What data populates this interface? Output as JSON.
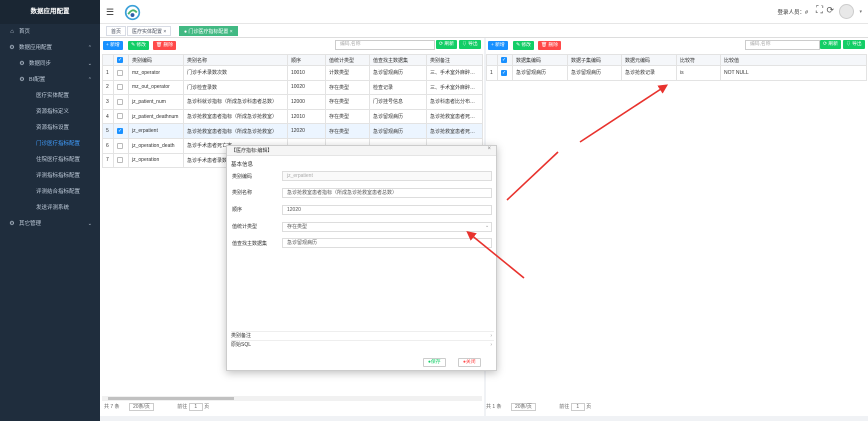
{
  "sidebar": {
    "title": "数据应用配置",
    "items": [
      {
        "label": "首页",
        "icon": "home-icon",
        "glyph": "⌂",
        "level": "top"
      },
      {
        "label": "数据应用配置",
        "icon": "gear-icon",
        "glyph": "⚙",
        "level": "top",
        "arrow": "⌃"
      },
      {
        "label": "数据同步",
        "icon": "gear-icon",
        "glyph": "⚙",
        "level": "sub",
        "arrow": "⌄"
      },
      {
        "label": "BI配置",
        "icon": "gear-icon",
        "glyph": "⚙",
        "level": "sub",
        "arrow": "⌃"
      },
      {
        "label": "医疗实体配置",
        "level": "leaf"
      },
      {
        "label": "资源指标定义",
        "level": "leaf"
      },
      {
        "label": "资源指标设置",
        "level": "leaf"
      },
      {
        "label": "门诊医疗指标配置",
        "level": "leaf",
        "active": true
      },
      {
        "label": "住院医疗指标配置",
        "level": "leaf"
      },
      {
        "label": "评测指标指标配置",
        "level": "leaf"
      },
      {
        "label": "评测结合指标配置",
        "level": "leaf"
      },
      {
        "label": "发送评测系统",
        "level": "leaf"
      },
      {
        "label": "其它管理",
        "icon": "gear-icon",
        "glyph": "⚙",
        "level": "top",
        "arrow": "⌄"
      }
    ]
  },
  "header": {
    "login_user": "登录人员：#",
    "hamburger": "☰",
    "fullscreen": "⛶",
    "refresh": "⟳",
    "avatar_caret": "▾"
  },
  "tabs": [
    {
      "label": "首页"
    },
    {
      "label": "医疗实体配置 ×"
    },
    {
      "label": "● 门诊医疗指标配置 ×",
      "active": true
    }
  ],
  "left": {
    "buttons": {
      "add": "+ 新增",
      "edit": "✎ 修改",
      "delete": "🗑 删除",
      "refresh": "⟳ 刷新",
      "export": "⇩ 导出"
    },
    "search_placeholder": "编码,名称",
    "columns": [
      "",
      "",
      "类别编码",
      "类别名称",
      "顺序",
      "值统计类型",
      "值查找主数据集",
      "类别备注"
    ],
    "rows": [
      {
        "n": "1",
        "checked": false,
        "code": "mz_operator",
        "name": "门诊手术录数次数",
        "order": "10010",
        "stat": "计数类型",
        "main": "急诊留观病历",
        "note": "三、手术室外麻醉占比"
      },
      {
        "n": "2",
        "checked": false,
        "code": "mz_out_operator",
        "name": "门诊检查录数",
        "order": "10020",
        "stat": "存在类型",
        "main": "检查记录",
        "note": "三、手术室外麻醉占比"
      },
      {
        "n": "3",
        "checked": false,
        "code": "jz_patient_num",
        "name": "急诊科就诊指标（所成急诊科患者总数）",
        "order": "12000",
        "stat": "存在类型",
        "main": "门诊挂号信息",
        "note": "急诊科患者比分布：同"
      },
      {
        "n": "4",
        "checked": false,
        "code": "jz_patient_deathnum",
        "name": "急诊抢救室患者指标（所成急诊抢救室）",
        "order": "12010",
        "stat": "存在类型",
        "main": "急诊留观病历",
        "note": "急诊抢救室患者死亡率"
      },
      {
        "n": "5",
        "checked": true,
        "code": "jz_erpatient",
        "name": "急诊抢救室患者指标（所成急诊抢救室）",
        "order": "12020",
        "stat": "存在类型",
        "main": "急诊留观病历",
        "note": "急诊抢救室患者死亡率",
        "selected": true
      },
      {
        "n": "6",
        "checked": false,
        "code": "jz_operation_death",
        "name": "急诊手术患者死亡率",
        "order": "",
        "stat": "",
        "main": "",
        "note": ""
      },
      {
        "n": "7",
        "checked": false,
        "code": "jz_operation",
        "name": "急诊手术患者录数",
        "order": "",
        "stat": "",
        "main": "",
        "note": ""
      }
    ],
    "pager": {
      "total": "共 7 条",
      "size": "20条/页",
      "goto": "前往",
      "page": "1",
      "unit": "页"
    }
  },
  "right": {
    "buttons": {
      "add": "+ 新增",
      "edit": "✎ 修改",
      "delete": "🗑 删除",
      "refresh": "⟳ 刷新",
      "export": "⇩ 导出"
    },
    "search_placeholder": "编码,名称",
    "columns": [
      "",
      "",
      "数据集编码",
      "数据子集编码",
      "数据元编码",
      "比较符",
      "比较值"
    ],
    "rows": [
      {
        "n": "1",
        "checked": true,
        "c1": "急诊留观病历",
        "c2": "急诊留观病历",
        "c3": "急诊抢救记录",
        "op": "is",
        "val": "NOT NULL"
      }
    ],
    "pager": {
      "total": "共 1 条",
      "size": "20条/页",
      "goto": "前往",
      "page": "1",
      "unit": "页"
    }
  },
  "dialog": {
    "title": "【医疗指标:编辑】",
    "close": "×",
    "section": "基本信息",
    "fields": [
      {
        "label": "类别编码",
        "value": "jz_erpatient",
        "readonly": true
      },
      {
        "label": "类别名称",
        "value": "急诊抢救室患者指标（所成急诊抢救室患者总数）"
      },
      {
        "label": "顺序",
        "value": "12020"
      },
      {
        "label": "值统计类型",
        "value": "存在类型"
      },
      {
        "label": "值查找主数据集",
        "value": "急诊留观病历"
      }
    ],
    "select_caret": "⌄",
    "collapse": [
      {
        "label": "类别备注"
      },
      {
        "label": "原始SQL"
      }
    ],
    "collapse_chev": "›",
    "save": "●保存",
    "close_btn": "●关闭"
  },
  "colors": {
    "accent": "#1890ff",
    "success": "#13ce66",
    "danger": "#ff4949",
    "sidebar": "#1f2d3d",
    "annotation": "#e8322d"
  }
}
